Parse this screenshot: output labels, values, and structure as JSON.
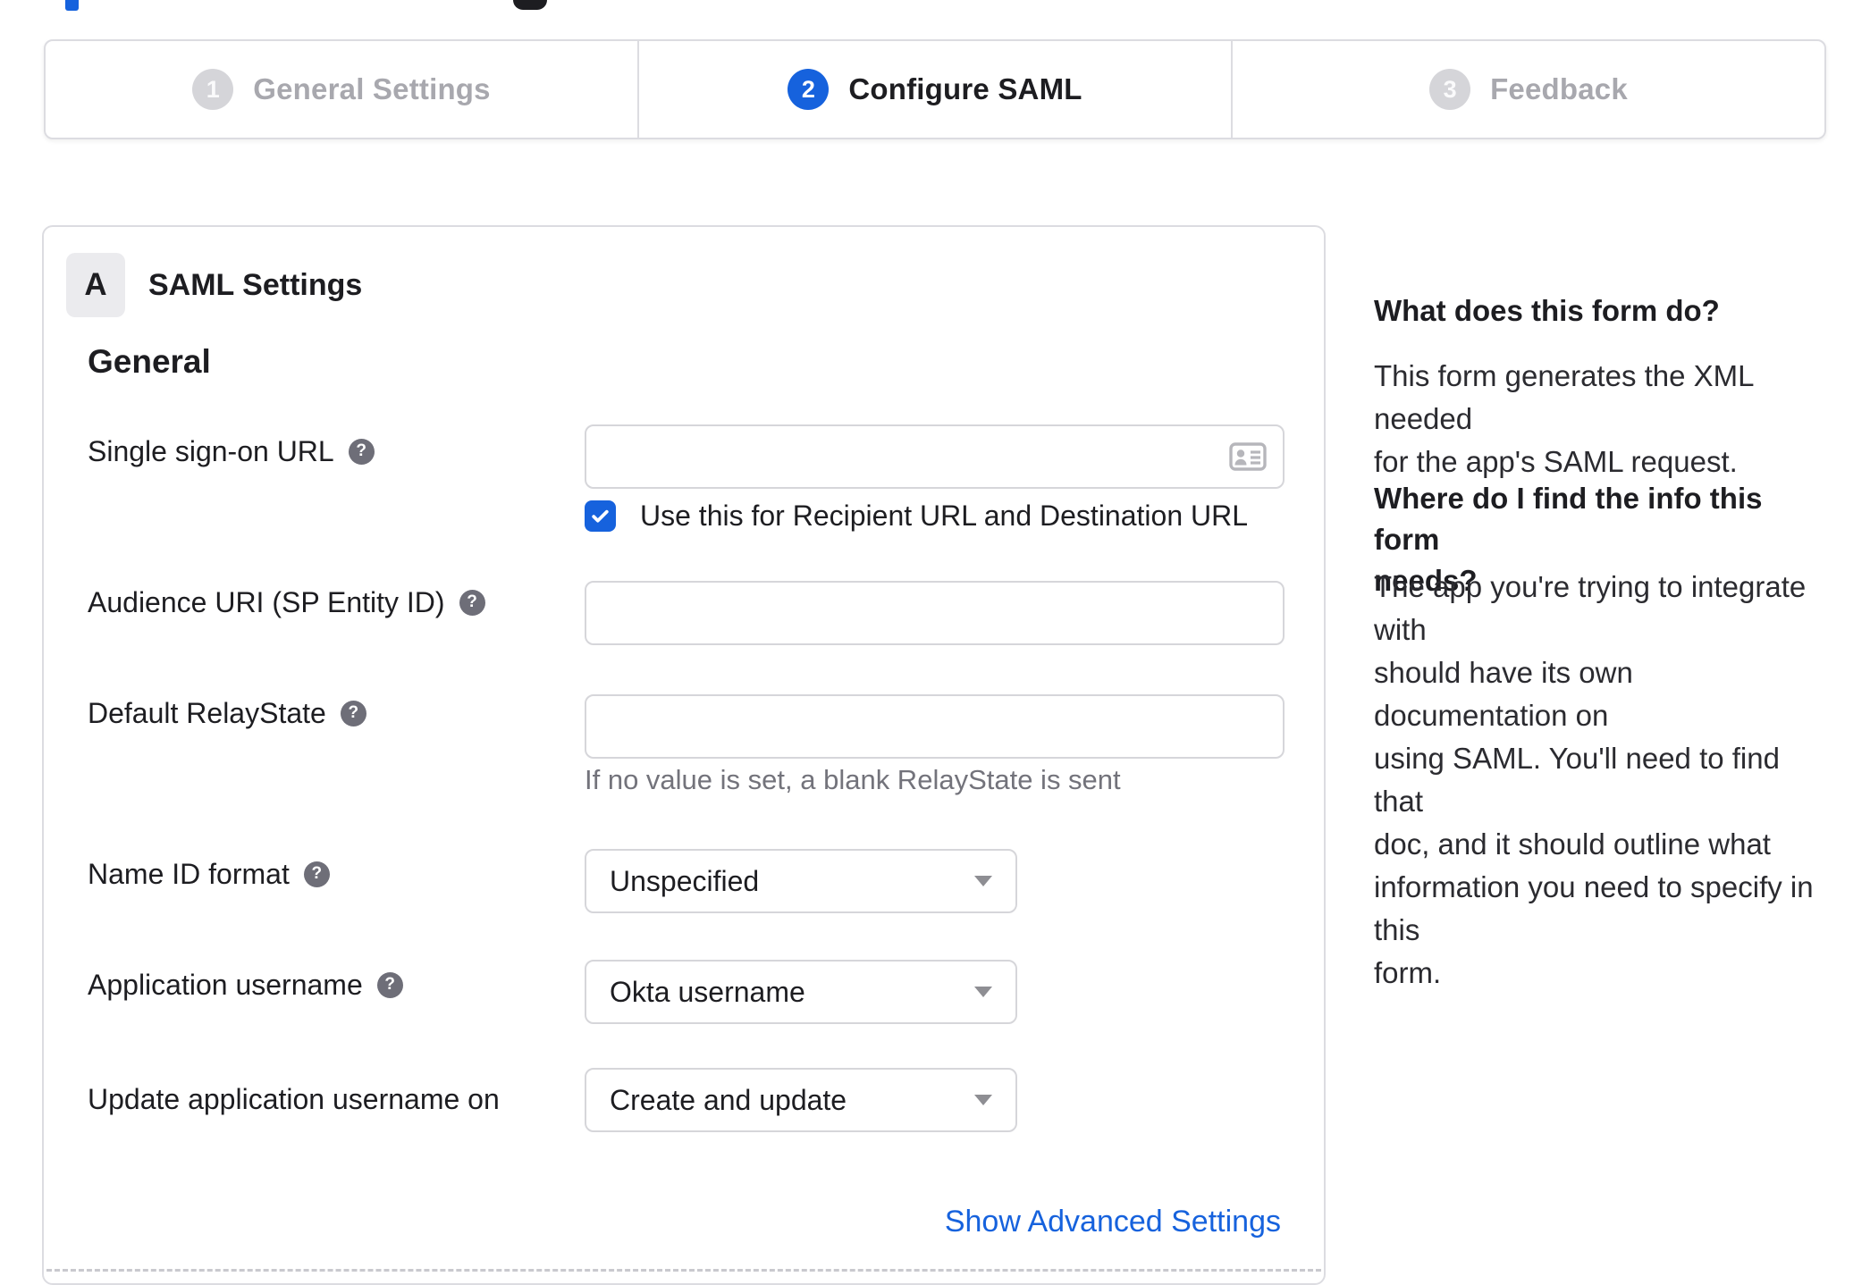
{
  "stepper": {
    "steps": [
      {
        "number": "1",
        "label": "General Settings",
        "state": "inactive"
      },
      {
        "number": "2",
        "label": "Configure SAML",
        "state": "active"
      },
      {
        "number": "3",
        "label": "Feedback",
        "state": "inactive"
      }
    ]
  },
  "form": {
    "badge": "A",
    "section_title": "SAML Settings",
    "group_heading": "General",
    "sso_label": "Single sign-on URL",
    "sso_value": "",
    "sso_checkbox_label": "Use this for Recipient URL and Destination URL",
    "sso_checkbox_checked": true,
    "audience_label": "Audience URI (SP Entity ID)",
    "audience_value": "",
    "relay_label": "Default RelayState",
    "relay_value": "",
    "relay_helper": "If no value is set, a blank RelayState is sent",
    "nameid_label": "Name ID format",
    "nameid_value": "Unspecified",
    "appuser_label": "Application username",
    "appuser_value": "Okta username",
    "update_label": "Update application username on",
    "update_value": "Create and update",
    "advanced_link": "Show Advanced Settings"
  },
  "help_panel": {
    "q1": "What does this form do?",
    "a1_lines": [
      "This form generates the XML needed",
      "for the app's SAML request."
    ],
    "q2_lines": [
      "Where do I find the info this form",
      "needs?"
    ],
    "a2_lines": [
      "The app you're trying to integrate with",
      "should have its own documentation on",
      "using SAML. You'll need to find that",
      "doc, and it should outline what",
      "information you need to specify in this",
      "form."
    ]
  },
  "colors": {
    "accent_blue": "#1662dd",
    "dark_text": "#1d1d21",
    "muted_text": "#73737b",
    "border_gray": "#dcdce1"
  }
}
